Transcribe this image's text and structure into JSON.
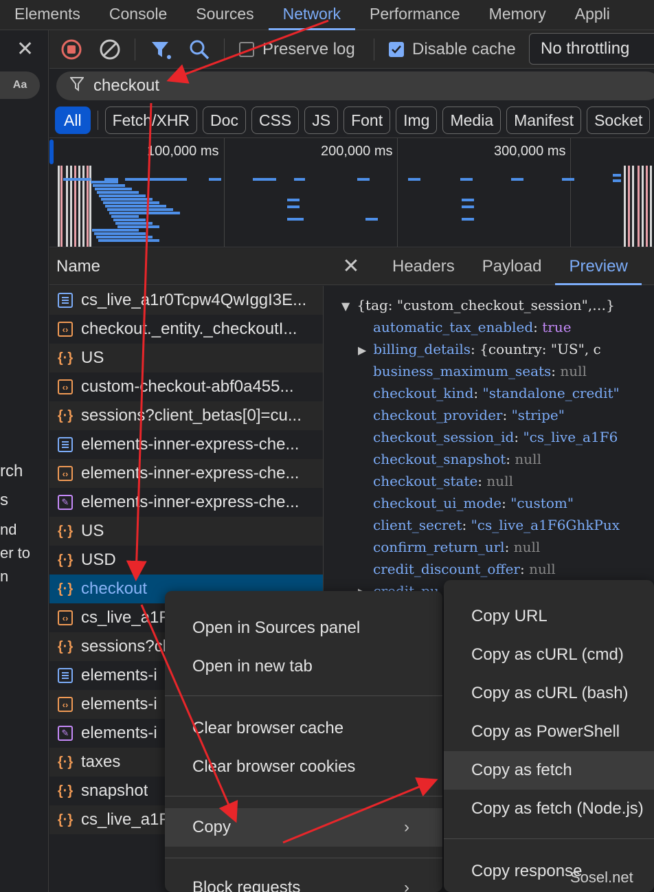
{
  "tabs": [
    "Elements",
    "Console",
    "Sources",
    "Network",
    "Performance",
    "Memory",
    "Appli"
  ],
  "active_tab": "Network",
  "left_panel": {
    "aa": "Aa",
    "cut_lines": [
      "rch",
      "s",
      "nd",
      "er to",
      "n"
    ]
  },
  "toolbar": {
    "preserve_log": "Preserve log",
    "preserve_log_checked": false,
    "disable_cache": "Disable cache",
    "disable_cache_checked": true,
    "throttling": "No throttling"
  },
  "filter": {
    "value": "checkout"
  },
  "type_filters": [
    "All",
    "Fetch/XHR",
    "Doc",
    "CSS",
    "JS",
    "Font",
    "Img",
    "Media",
    "Manifest",
    "Socket"
  ],
  "active_type_filter": "All",
  "overview": {
    "ticks": [
      "100,000 ms",
      "200,000 ms",
      "300,000 ms"
    ]
  },
  "list_header": "Name",
  "requests": [
    {
      "name": "cs_live_a1r0Tcpw4QwIggI3E...",
      "type": "doc"
    },
    {
      "name": "checkout._entity._checkoutI...",
      "type": "script"
    },
    {
      "name": "US",
      "type": "fetch"
    },
    {
      "name": "custom-checkout-abf0a455...",
      "type": "script"
    },
    {
      "name": "sessions?client_betas[0]=cu...",
      "type": "fetch"
    },
    {
      "name": "elements-inner-express-che...",
      "type": "doc"
    },
    {
      "name": "elements-inner-express-che...",
      "type": "script"
    },
    {
      "name": "elements-inner-express-che...",
      "type": "style"
    },
    {
      "name": "US",
      "type": "fetch"
    },
    {
      "name": "USD",
      "type": "fetch"
    },
    {
      "name": "checkout",
      "type": "fetch",
      "selected": true
    },
    {
      "name": "cs_live_a1F",
      "type": "script"
    },
    {
      "name": "sessions?cl",
      "type": "fetch"
    },
    {
      "name": "elements-i",
      "type": "doc"
    },
    {
      "name": "elements-i",
      "type": "script"
    },
    {
      "name": "elements-i",
      "type": "style"
    },
    {
      "name": "taxes",
      "type": "fetch"
    },
    {
      "name": "snapshot",
      "type": "fetch"
    },
    {
      "name": "cs_live_a1F",
      "type": "fetch"
    }
  ],
  "detail_tabs": [
    "Headers",
    "Payload",
    "Preview"
  ],
  "active_detail_tab": "Preview",
  "preview": {
    "root": "{tag: \"custom_checkout_session\",…}",
    "lines": [
      {
        "key": "automatic_tax_enabled",
        "value": "true",
        "kind": "bool"
      },
      {
        "key": "billing_details",
        "value": "{country: \"US\", c",
        "kind": "plain",
        "expandable": true
      },
      {
        "key": "business_maximum_seats",
        "value": "null",
        "kind": "null"
      },
      {
        "key": "checkout_kind",
        "value": "\"standalone_credit\"",
        "kind": "str"
      },
      {
        "key": "checkout_provider",
        "value": "\"stripe\"",
        "kind": "str"
      },
      {
        "key": "checkout_session_id",
        "value": "\"cs_live_a1F6",
        "kind": "str"
      },
      {
        "key": "checkout_snapshot",
        "value": "null",
        "kind": "null"
      },
      {
        "key": "checkout_state",
        "value": "null",
        "kind": "null"
      },
      {
        "key": "checkout_ui_mode",
        "value": "\"custom\"",
        "kind": "str"
      },
      {
        "key": "client_secret",
        "value": "\"cs_live_a1F6GhkPux",
        "kind": "str"
      },
      {
        "key": "confirm_return_url",
        "value": "null",
        "kind": "null"
      },
      {
        "key": "credit_discount_offer",
        "value": "null",
        "kind": "null"
      },
      {
        "key": "credit_pu",
        "value": "",
        "kind": "plain",
        "expandable": true
      }
    ]
  },
  "context_menu": {
    "items": [
      "Open in Sources panel",
      "Open in new tab",
      "Clear browser cache",
      "Clear browser cookies",
      "Copy",
      "Block requests"
    ],
    "submenu_arrow": "›"
  },
  "copy_submenu": {
    "items": [
      "Copy URL",
      "Copy as cURL (cmd)",
      "Copy as cURL (bash)",
      "Copy as PowerShell",
      "Copy as fetch",
      "Copy as fetch (Node.js)",
      "Copy response"
    ],
    "highlighted": "Copy as fetch"
  },
  "watermark": "Sosel.net",
  "colors": {
    "accent": "#7cacf8",
    "arrow": "#e8262a",
    "selected_row": "#004a77",
    "chip_active": "#0b57d0"
  }
}
